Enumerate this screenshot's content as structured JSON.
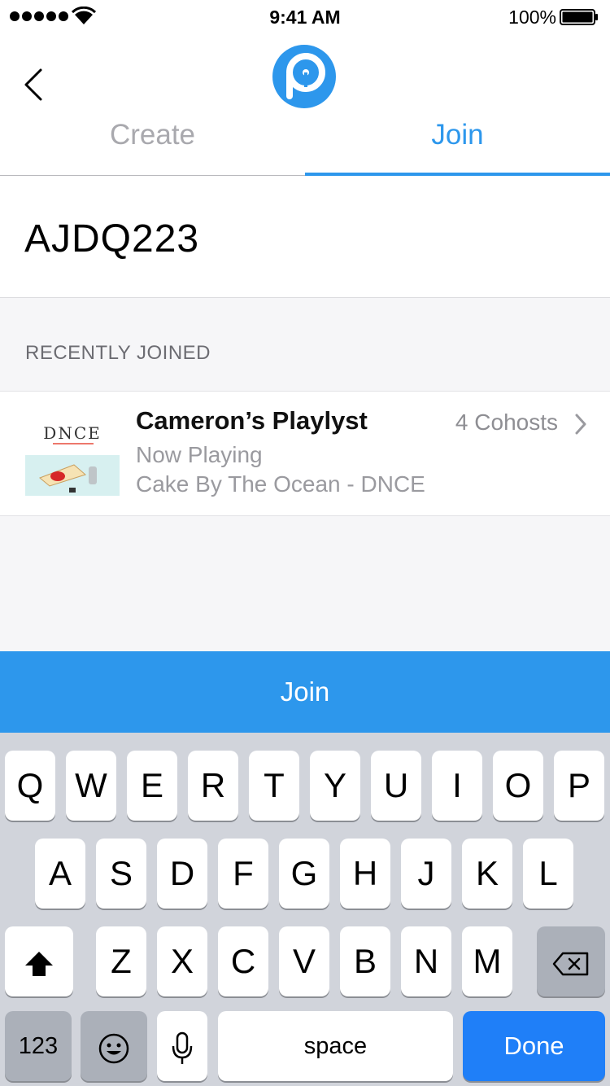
{
  "status_bar": {
    "time": "9:41 AM",
    "battery": "100%"
  },
  "tabs": {
    "create": "Create",
    "join": "Join"
  },
  "code_input": {
    "value": "AJDQ223"
  },
  "recent": {
    "header": "RECENTLY JOINED",
    "items": [
      {
        "title": "Cameron’s Playlyst",
        "cohosts": "4 Cohosts",
        "status": "Now Playing",
        "track": "Cake By The Ocean - DNCE",
        "album_art_text": "DNCE"
      }
    ]
  },
  "join_button": {
    "label": "Join"
  },
  "keyboard": {
    "row1": [
      "Q",
      "W",
      "E",
      "R",
      "T",
      "Y",
      "U",
      "I",
      "O",
      "P"
    ],
    "row2": [
      "A",
      "S",
      "D",
      "F",
      "G",
      "H",
      "J",
      "K",
      "L"
    ],
    "row3": [
      "Z",
      "X",
      "C",
      "V",
      "B",
      "N",
      "M"
    ],
    "numbers_key": "123",
    "space_key": "space",
    "done_key": "Done"
  },
  "colors": {
    "accent": "#2d97ec",
    "done_key": "#1f7ff8",
    "keyboard_bg": "#d1d4db"
  },
  "icons": [
    "signal-icon",
    "wifi-icon",
    "battery-icon",
    "back-chevron-icon",
    "app-logo",
    "chevron-right-icon",
    "shift-icon",
    "backspace-icon",
    "emoji-icon",
    "mic-icon"
  ]
}
